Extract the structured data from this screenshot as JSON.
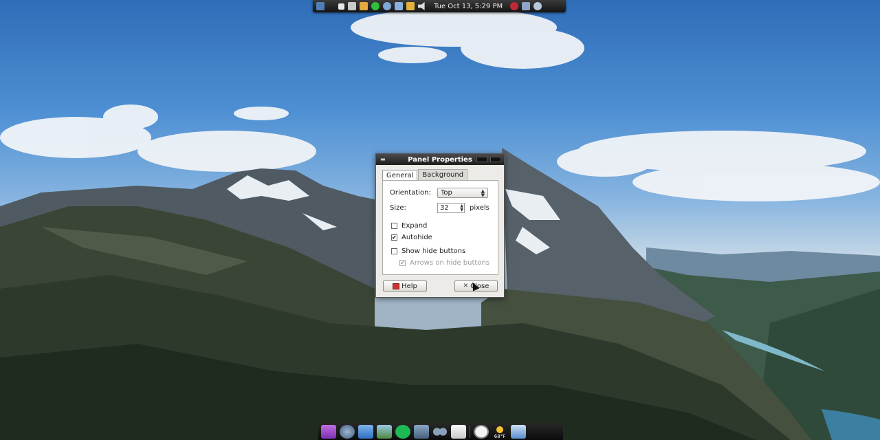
{
  "top_panel": {
    "clock": "Tue Oct 13,  5:29 PM"
  },
  "dialog": {
    "title": "Panel Properties",
    "tabs": [
      {
        "label": "General",
        "active": true
      },
      {
        "label": "Background",
        "active": false
      }
    ],
    "orientation": {
      "label": "Orientation:",
      "value": "Top"
    },
    "size": {
      "label": "Size:",
      "value": "32",
      "unit": "pixels"
    },
    "checkboxes": [
      {
        "label": "Expand",
        "checked": false,
        "enabled": true
      },
      {
        "label": "Autohide",
        "checked": true,
        "enabled": true
      },
      {
        "label": "Show hide buttons",
        "checked": false,
        "enabled": true
      },
      {
        "label": "Arrows on hide buttons",
        "checked": true,
        "enabled": false
      }
    ],
    "help_label": "Help",
    "close_label": "Close"
  },
  "dock": {
    "weather_temp": "68°F"
  },
  "colors": {
    "panel_bg": "#1e1e1e",
    "dialog_bg": "#ecebe8",
    "sky": "#4d8fd3"
  }
}
